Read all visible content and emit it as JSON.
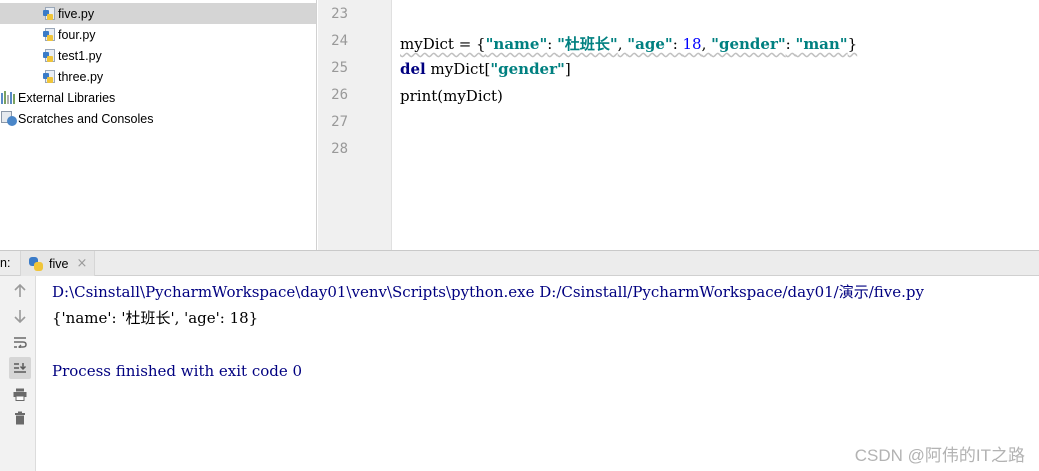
{
  "project_tree": {
    "items": [
      {
        "label": "five.py",
        "icon": "python-file-icon",
        "selected": true
      },
      {
        "label": "four.py",
        "icon": "python-file-icon",
        "selected": false
      },
      {
        "label": "test1.py",
        "icon": "python-file-icon",
        "selected": false
      },
      {
        "label": "three.py",
        "icon": "python-file-icon",
        "selected": false
      },
      {
        "label": "External Libraries",
        "icon": "libraries-icon",
        "selected": false
      },
      {
        "label": "Scratches and Consoles",
        "icon": "scratches-icon",
        "selected": false
      }
    ]
  },
  "editor": {
    "line_numbers": [
      "23",
      "24",
      "25",
      "26",
      "27",
      "28"
    ],
    "lines": {
      "l24": {
        "p1": "myDict = {",
        "s1": "\"name\"",
        "p2": ": ",
        "s2": "\"杜班长\"",
        "p3": ", ",
        "s3": "\"age\"",
        "p4": ": ",
        "n1": "18",
        "p5": ", ",
        "s4": "\"gender\"",
        "p6": ": ",
        "s5": "\"man\"",
        "p7": "}"
      },
      "l25": {
        "kw": "del",
        "p1": " myDict[",
        "s1": "\"gender\"",
        "p2": "]"
      },
      "l26": {
        "text": "print(myDict)"
      }
    }
  },
  "run": {
    "prefix": "n:",
    "tab_label": "five",
    "close_glyph": "×"
  },
  "console": {
    "command": "D:\\Csinstall\\PycharmWorkspace\\day01\\venv\\Scripts\\python.exe D:/Csinstall/PycharmWorkspace/day01/演示/five.py",
    "output": "{'name': '杜班长', 'age': 18}",
    "exit": "Process finished with exit code 0"
  },
  "toolbar_icons": [
    "up-arrow-icon",
    "down-arrow-icon",
    "soft-wrap-icon",
    "scroll-to-end-icon",
    "print-icon",
    "trash-icon"
  ],
  "watermark": "CSDN @阿伟的IT之路",
  "colors": {
    "keyword": "#000080",
    "string": "#008080",
    "number": "#0000ff",
    "console_command": "#000080"
  }
}
